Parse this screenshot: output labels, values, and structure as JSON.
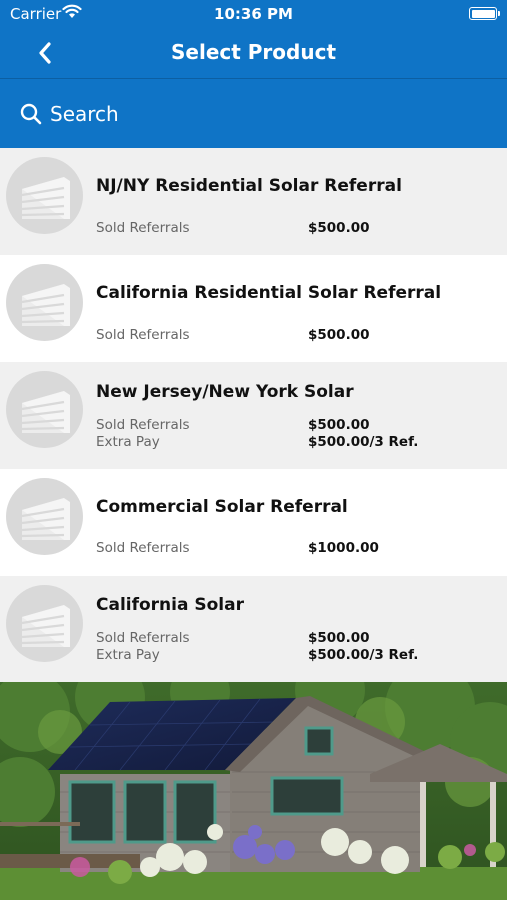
{
  "status_bar": {
    "carrier": "Carrier",
    "time": "10:36 PM"
  },
  "nav": {
    "title": "Select Product"
  },
  "search": {
    "placeholder": "Search"
  },
  "products": [
    {
      "name": "NJ/NY Residential Solar Referral",
      "sold_label": "Sold Referrals",
      "sold_value": "$500.00"
    },
    {
      "name": "California Residential Solar Referral",
      "sold_label": "Sold Referrals",
      "sold_value": "$500.00"
    },
    {
      "name": "New Jersey/New York Solar",
      "sold_label": "Sold Referrals",
      "sold_value": "$500.00",
      "extra_label": "Extra Pay",
      "extra_value": "$500.00/3 Ref."
    },
    {
      "name": "Commercial Solar Referral",
      "sold_label": "Sold Referrals",
      "sold_value": "$1000.00"
    },
    {
      "name": "California Solar",
      "sold_label": "Sold Referrals",
      "sold_value": "$500.00",
      "extra_label": "Extra Pay",
      "extra_value": "$500.00/3 Ref."
    }
  ],
  "colors": {
    "header": "#0f74c6",
    "row_alt": "#f0f0f0",
    "thumb": "#d9d9d9"
  },
  "icons": {
    "back": "chevron-left-icon",
    "search": "magnifier-icon",
    "product": "building-icon"
  }
}
